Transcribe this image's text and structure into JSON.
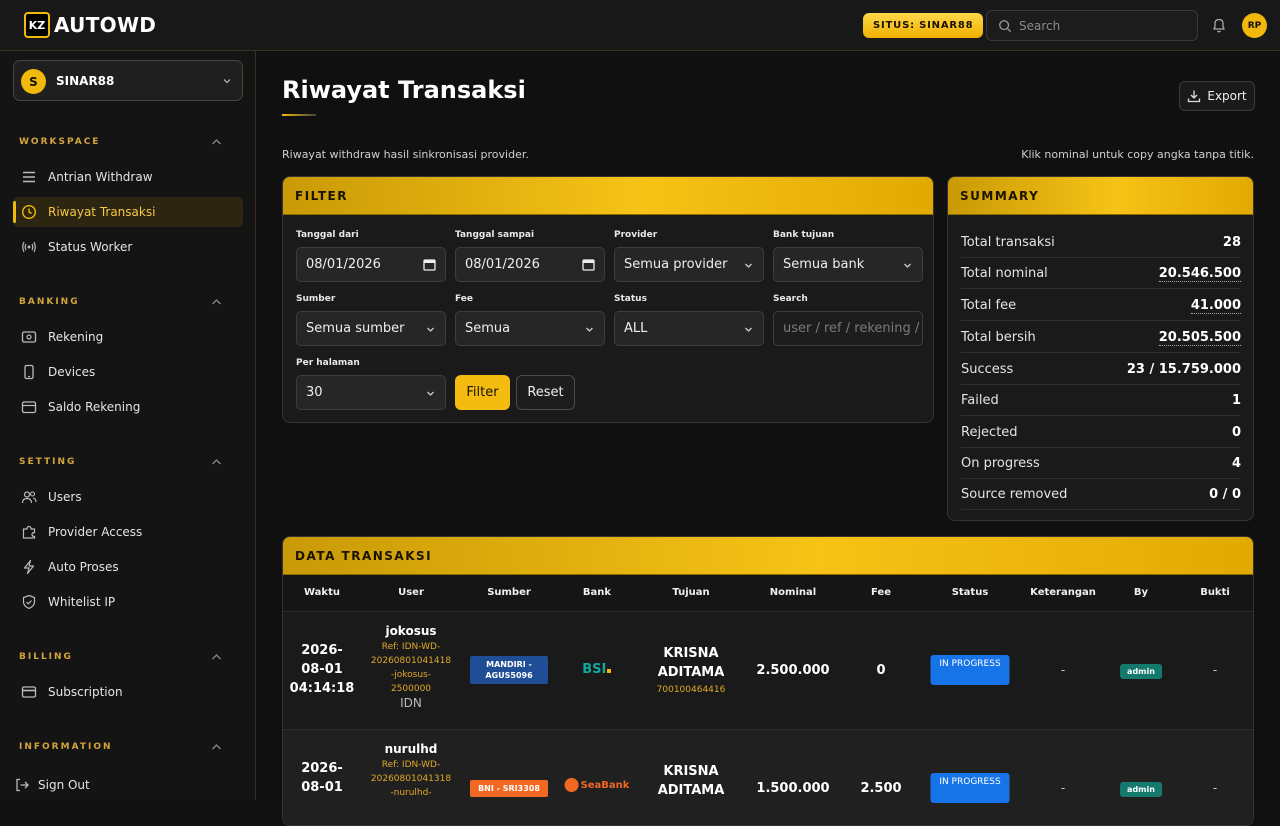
{
  "brand": {
    "mark": "KZ",
    "name": "AUTOWD"
  },
  "topbar": {
    "site_badge": "SITUS: SINAR88",
    "search_placeholder": "Search",
    "user_initials": "RP"
  },
  "sidebar": {
    "workspace": {
      "initial": "S",
      "name": "SINAR88"
    },
    "sections": [
      {
        "title": "WORKSPACE",
        "items": [
          {
            "label": "Antrian Withdraw",
            "icon": "list-icon"
          },
          {
            "label": "Riwayat Transaksi",
            "icon": "clock-icon",
            "active": true
          },
          {
            "label": "Status Worker",
            "icon": "broadcast-icon"
          }
        ]
      },
      {
        "title": "BANKING",
        "items": [
          {
            "label": "Rekening",
            "icon": "bank-card-icon"
          },
          {
            "label": "Devices",
            "icon": "phone-icon"
          },
          {
            "label": "Saldo Rekening",
            "icon": "wallet-icon"
          }
        ]
      },
      {
        "title": "SETTING",
        "items": [
          {
            "label": "Users",
            "icon": "users-icon"
          },
          {
            "label": "Provider Access",
            "icon": "puzzle-icon"
          },
          {
            "label": "Auto Proses",
            "icon": "bolt-icon"
          },
          {
            "label": "Whitelist IP",
            "icon": "shield-icon"
          }
        ]
      },
      {
        "title": "BILLING",
        "items": [
          {
            "label": "Subscription",
            "icon": "credit-card-icon"
          }
        ]
      },
      {
        "title": "INFORMATION",
        "items": []
      }
    ],
    "sign_out": "Sign Out"
  },
  "main": {
    "title": "Riwayat Transaksi",
    "export_label": "Export",
    "subtitle": "Riwayat withdraw hasil sinkronisasi provider.",
    "hint": "Klik nominal untuk copy angka tanpa titik."
  },
  "filter": {
    "title": "FILTER",
    "tanggal_dari": {
      "label": "Tanggal dari",
      "value": "08/01/2026"
    },
    "tanggal_sampai": {
      "label": "Tanggal sampai",
      "value": "08/01/2026"
    },
    "provider": {
      "label": "Provider",
      "value": "Semua provider"
    },
    "bank_tujuan": {
      "label": "Bank tujuan",
      "value": "Semua bank"
    },
    "sumber": {
      "label": "Sumber",
      "value": "Semua sumber"
    },
    "fee": {
      "label": "Fee",
      "value": "Semua"
    },
    "status": {
      "label": "Status",
      "value": "ALL"
    },
    "search": {
      "label": "Search",
      "placeholder": "user / ref / rekening /"
    },
    "per_halaman": {
      "label": "Per halaman",
      "value": "30"
    },
    "filter_button": "Filter",
    "reset_button": "Reset"
  },
  "summary": {
    "title": "SUMMARY",
    "rows": [
      {
        "label": "Total transaksi",
        "value": "28"
      },
      {
        "label": "Total nominal",
        "value": "20.546.500",
        "copy": true
      },
      {
        "label": "Total fee",
        "value": "41.000",
        "copy": true
      },
      {
        "label": "Total bersih",
        "value": "20.505.500",
        "copy": true
      },
      {
        "label": "Success",
        "value": "23 / 15.759.000"
      },
      {
        "label": "Failed",
        "value": "1"
      },
      {
        "label": "Rejected",
        "value": "0"
      },
      {
        "label": "On progress",
        "value": "4"
      },
      {
        "label": "Source removed",
        "value": "0 / 0"
      }
    ]
  },
  "table": {
    "title": "DATA TRANSAKSI",
    "columns": [
      "Waktu",
      "User",
      "Sumber",
      "Bank",
      "Tujuan",
      "Nominal",
      "Fee",
      "Status",
      "Keterangan",
      "By",
      "Bukti"
    ],
    "rows": [
      {
        "time1": "2026-",
        "time2": "08-01",
        "time3": "04:14:18",
        "user": "jokosus",
        "ref1": "Ref: IDN-WD-",
        "ref2": "20260801041418",
        "ref3": "-jokosus-",
        "ref4": "2500000",
        "region": "IDN",
        "source": "MANDIRI - AGUS5096",
        "source_color": "#1f4e96",
        "bank": "BSI",
        "bank_color": "#13a89e",
        "dest_name1": "KRISNA",
        "dest_name2": "ADITAMA",
        "dest_acc": "700100464416",
        "nominal": "2.500.000",
        "fee": "0",
        "status": "IN PROGRESS",
        "note": "-",
        "by": "admin",
        "proof": "-"
      },
      {
        "time1": "2026-",
        "time2": "08-01",
        "time3": "",
        "user": "nurulhd",
        "ref1": "Ref: IDN-WD-",
        "ref2": "20260801041318",
        "ref3": "-nurulhd-",
        "ref4": "",
        "region": "",
        "source": "BNI - SRI3308",
        "source_color": "#f26722",
        "bank": "SeaBank",
        "bank_color": "#f26722",
        "dest_name1": "KRISNA",
        "dest_name2": "ADITAMA",
        "dest_acc": "",
        "nominal": "1.500.000",
        "fee": "2.500",
        "status": "IN PROGRESS",
        "note": "-",
        "by": "admin",
        "proof": "-"
      }
    ]
  },
  "colors": {
    "accent": "#f0b90b",
    "status_in_progress": "#1673e8",
    "by_badge": "#147a6e"
  }
}
